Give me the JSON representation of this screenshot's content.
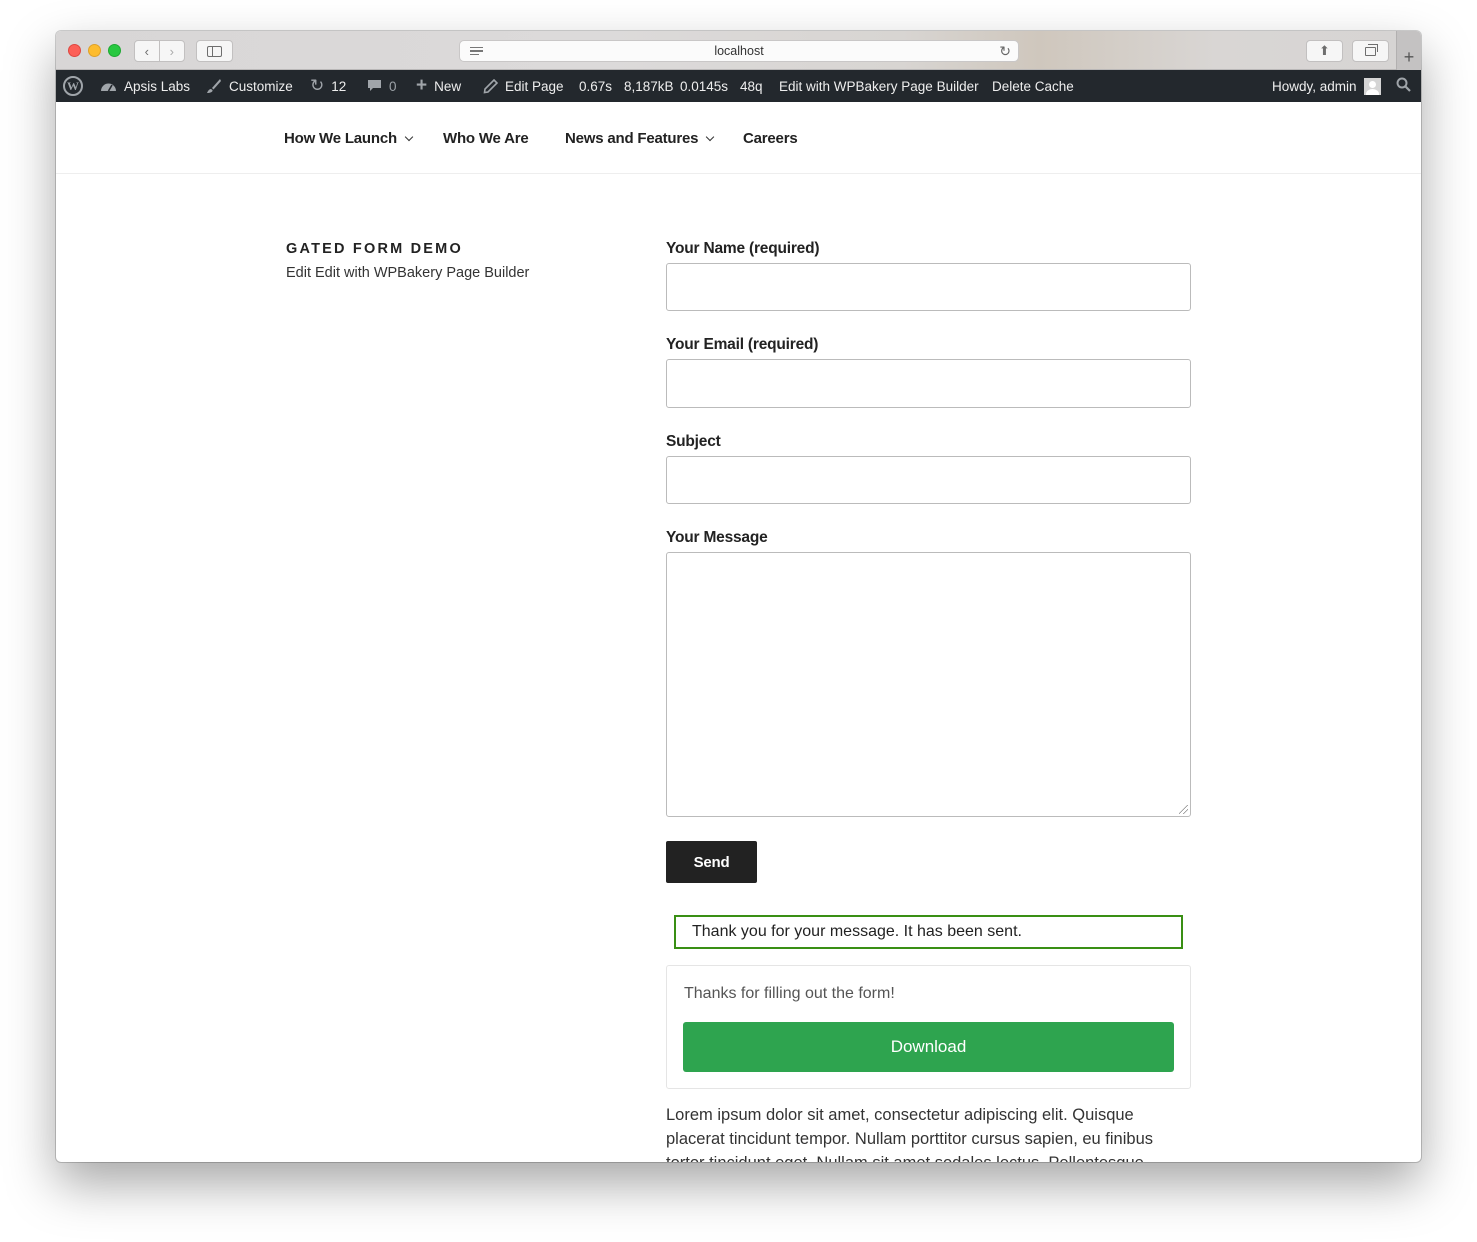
{
  "browser": {
    "url": "localhost"
  },
  "adminbar": {
    "site_name": "Apsis Labs",
    "customize": "Customize",
    "updates_count": "12",
    "comments_count": "0",
    "new": "New",
    "edit_page": "Edit Page",
    "stat_time": "0.67s",
    "stat_memory": "8,187kB",
    "stat_query_time": "0.0145s",
    "stat_queries": "48q",
    "wpbakery": "Edit with WPBakery Page Builder",
    "delete_cache": "Delete Cache",
    "howdy": "Howdy, admin"
  },
  "nav": {
    "items": [
      {
        "label": "How We Launch",
        "has_dropdown": true
      },
      {
        "label": "Who We Are",
        "has_dropdown": false
      },
      {
        "label": "News and Features",
        "has_dropdown": true
      },
      {
        "label": "Careers",
        "has_dropdown": false
      }
    ]
  },
  "page": {
    "title": "GATED FORM DEMO",
    "edit_link": "Edit",
    "wpbakery_link": "Edit with WPBakery Page Builder"
  },
  "form": {
    "name_label": "Your Name (required)",
    "name_value": "",
    "email_label": "Your Email (required)",
    "email_value": "",
    "subject_label": "Subject",
    "subject_value": "",
    "message_label": "Your Message",
    "message_value": "",
    "send_label": "Send",
    "sent_message": "Thank you for your message. It has been sent."
  },
  "gate": {
    "thanks_text": "Thanks for filling out the form!",
    "download_label": "Download",
    "download_color": "#2ea44f"
  },
  "content": {
    "lorem": "Lorem ipsum dolor sit amet, consectetur adipiscing elit. Quisque placerat tincidunt tempor. Nullam porttitor cursus sapien, eu finibus tortor tincidunt eget. Nullam sit amet sodales lectus. Pellentesque"
  },
  "colors": {
    "adminbar_bg": "#23282d",
    "send_button_bg": "#222222",
    "sent_border": "#398f14"
  }
}
